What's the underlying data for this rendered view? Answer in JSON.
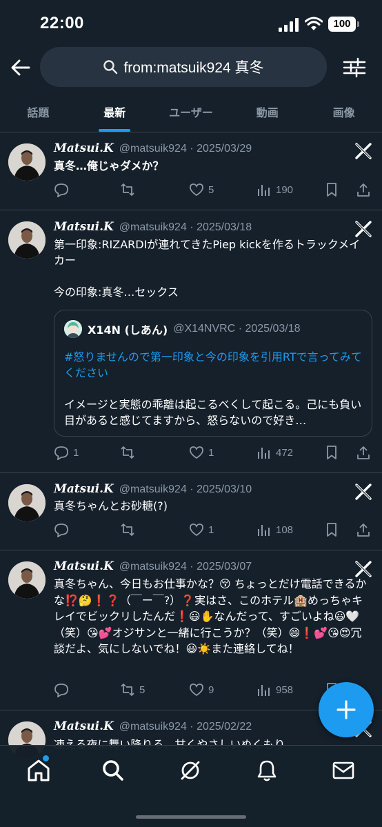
{
  "status": {
    "time": "22:00",
    "battery": "100"
  },
  "search": {
    "query": "from:matsuik924 真冬"
  },
  "tabs": [
    {
      "label": "話題"
    },
    {
      "label": "最新"
    },
    {
      "label": "ユーザー"
    },
    {
      "label": "動画"
    },
    {
      "label": "画像"
    }
  ],
  "tweets": [
    {
      "name": "𝑴𝒂𝒕𝒔𝒖𝒊.𝑲",
      "meta": "@matsuik924 · 2025/03/29",
      "text": "真冬…俺じゃダメか？",
      "replies": "",
      "retweets": "",
      "likes": "5",
      "views": "190"
    },
    {
      "name": "𝑴𝒂𝒕𝒔𝒖𝒊.𝑲",
      "meta": "@matsuik924 · 2025/03/18",
      "text": "第一印象:RIZARDIが連れてきたPiep kickを作るトラックメイカー\n\n今の印象:真冬…セックス",
      "replies": "1",
      "retweets": "",
      "likes": "1",
      "views": "472",
      "quote": {
        "name": "X14N (しあん)",
        "meta": "@X14NVRC · 2025/03/18",
        "hashtag": "#怒りませんので第一印象と今の印象を引用RTで言ってみてください",
        "text": "イメージと実態の乖離は起こるべくして起こる。己にも負い目があると感じてますから、怒らないので好き…"
      }
    },
    {
      "name": "𝑴𝒂𝒕𝒔𝒖𝒊.𝑲",
      "meta": "@matsuik924 · 2025/03/10",
      "text": "真冬ちゃんとお砂糖(?)",
      "replies": "",
      "retweets": "",
      "likes": "1",
      "views": "108"
    },
    {
      "name": "𝑴𝒂𝒕𝒔𝒖𝒊.𝑲",
      "meta": "@matsuik924 · 2025/03/07",
      "text": "真冬ちゃん、今日もお仕事かな？😚 ちょっとだけ電話できるかな⁉️🤔❗❓（￣ー￣?）❓実はさ、このホテル🏨めっちゃキレイでビックリしたんだ❗😃✋なんだって、すごいよね😃🤍（笑）😘💕オジサンと一緒に行こうか？（笑）😄❗💕😘😍冗談だよ、気にしないでね！😃☀️また連絡してね！",
      "replies": "",
      "retweets": "5",
      "likes": "9",
      "views": "958"
    },
    {
      "name": "𝑴𝒂𝒕𝒔𝒖𝒊.𝑲",
      "meta": "@matsuik924 · 2025/02/22",
      "text": "凍える夜に舞い降りる、甘くやさしいぬくもり"
    }
  ],
  "colors": {
    "accent": "#1d9bf0",
    "background": "#15202b",
    "muted": "#8b98a5"
  },
  "icons": {
    "nav": [
      "home-icon",
      "search-icon",
      "grok-icon",
      "bell-icon",
      "mail-icon"
    ],
    "fab": "plus-icon"
  }
}
